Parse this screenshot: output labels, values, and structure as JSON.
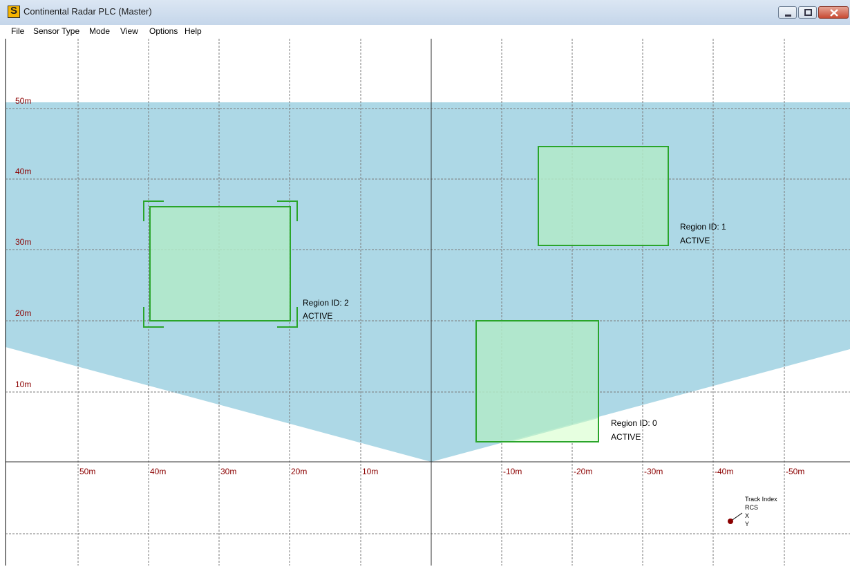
{
  "window": {
    "title": "Continental Radar PLC (Master)",
    "icon": "app-logo-icon"
  },
  "menu": [
    "File",
    "Sensor Type",
    "Mode",
    "View",
    "Options",
    "Help"
  ],
  "colors": {
    "coverage": "#add8e6",
    "region_fill": "#b2eac8",
    "region_border": "#2aa52a",
    "axis_label": "#8b0000",
    "grid": "#7a7a7a",
    "track_dot": "#8b0000"
  },
  "radar": {
    "y_labels": [
      "50m",
      "40m",
      "30m",
      "20m",
      "10m"
    ],
    "x_labels": [
      "50m",
      "40m",
      "30m",
      "20m",
      "10m",
      "-10m",
      "-20m",
      "-30m",
      "-40m",
      "-50m"
    ],
    "regions": [
      {
        "id_label": "Region ID: 2",
        "status": "ACTIVE",
        "selected": true
      },
      {
        "id_label": "Region ID: 1",
        "status": "ACTIVE",
        "selected": false
      },
      {
        "id_label": "Region ID: 0",
        "status": "ACTIVE",
        "selected": false
      }
    ],
    "track_legend": [
      "Track Index",
      "RCS",
      "X",
      "Y"
    ]
  }
}
